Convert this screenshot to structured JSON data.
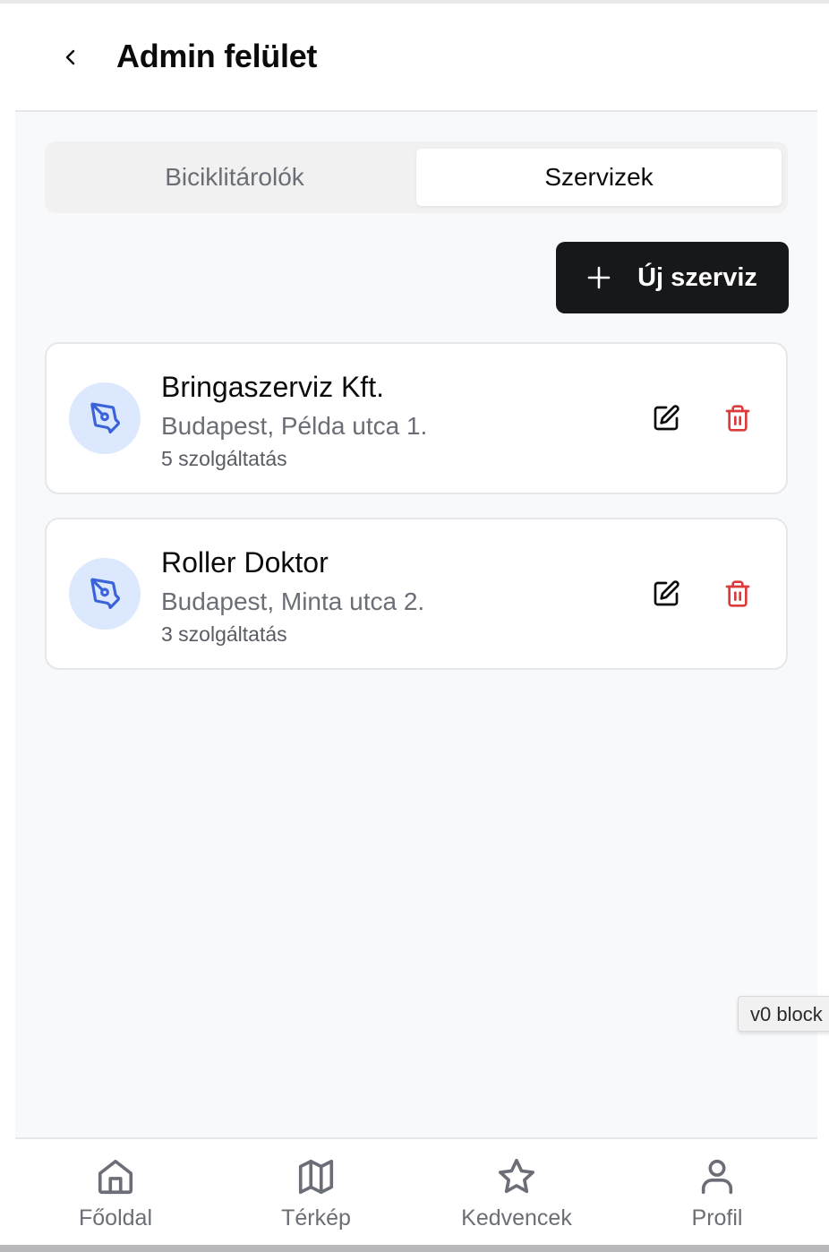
{
  "header": {
    "title": "Admin felület",
    "back_icon": "chevron-left-icon"
  },
  "tabs": [
    {
      "label": "Biciklitárolók",
      "active": false
    },
    {
      "label": "Szervizek",
      "active": true
    }
  ],
  "actions": {
    "new_service_label": "Új szerviz",
    "new_service_icon": "plus-icon"
  },
  "services": [
    {
      "name": "Bringaszerviz Kft.",
      "address": "Budapest, Példa utca 1.",
      "services_count": "5 szolgáltatás",
      "icon": "pen-tool-icon"
    },
    {
      "name": "Roller Doktor",
      "address": "Budapest, Minta utca 2.",
      "services_count": "3 szolgáltatás",
      "icon": "pen-tool-icon"
    }
  ],
  "badge": {
    "label": "v0 block"
  },
  "bottom_nav": [
    {
      "label": "Főoldal",
      "icon": "home-icon"
    },
    {
      "label": "Térkép",
      "icon": "map-icon"
    },
    {
      "label": "Kedvencek",
      "icon": "star-icon"
    },
    {
      "label": "Profil",
      "icon": "user-icon"
    }
  ],
  "colors": {
    "accent_blue": "#3b63d9",
    "avatar_bg": "#dbe8fd",
    "delete_red": "#dc3b3b",
    "primary_button": "#17181a",
    "background": "#f8f9fb"
  }
}
